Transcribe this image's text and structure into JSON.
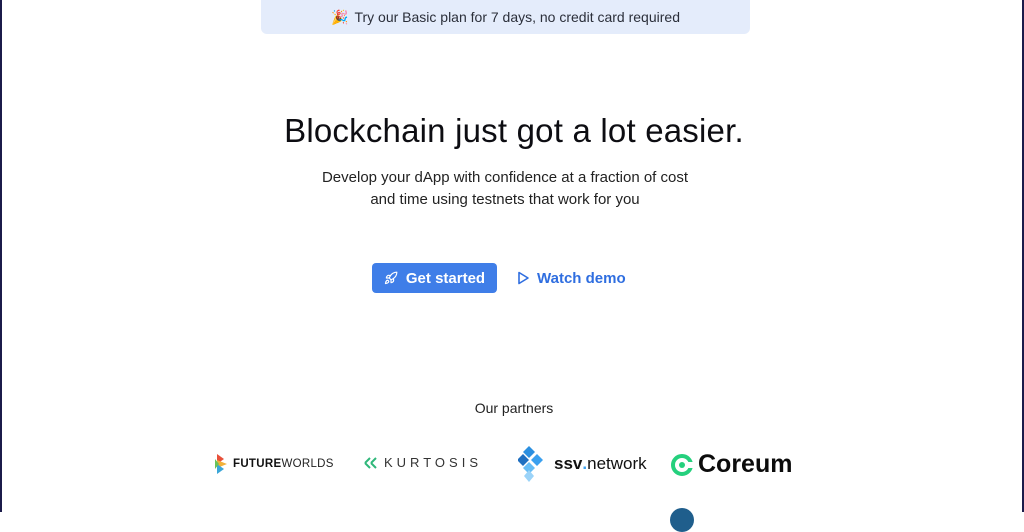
{
  "promo": {
    "emoji": "🎉",
    "text": "Try our Basic plan for 7 days, no credit card required"
  },
  "hero": {
    "title": "Blockchain just got a lot easier.",
    "subtitle_line1": "Develop your dApp with confidence at a fraction of cost",
    "subtitle_line2": "and time using testnets that work for you"
  },
  "actions": {
    "primary_label": "Get started",
    "primary_icon": "rocket-icon",
    "secondary_label": "Watch demo",
    "secondary_icon": "play-icon"
  },
  "partners": {
    "title": "Our partners",
    "logos": [
      {
        "name": "future-worlds-logo",
        "bold": "FUTURE",
        "light": "WORLDS"
      },
      {
        "name": "kurtosis-logo",
        "text": "KURTOSIS"
      },
      {
        "name": "ssv-network-logo",
        "pre": "ssv",
        "dot": ".",
        "post": "network"
      },
      {
        "name": "coreum-logo",
        "text": "Coreum"
      }
    ]
  },
  "colors": {
    "accent": "#3f7ee8",
    "link": "#2f6ee0",
    "promo_bg": "#e4ecfb",
    "coreum_green": "#25d07d",
    "ssv_blue": "#3aa0ef"
  }
}
